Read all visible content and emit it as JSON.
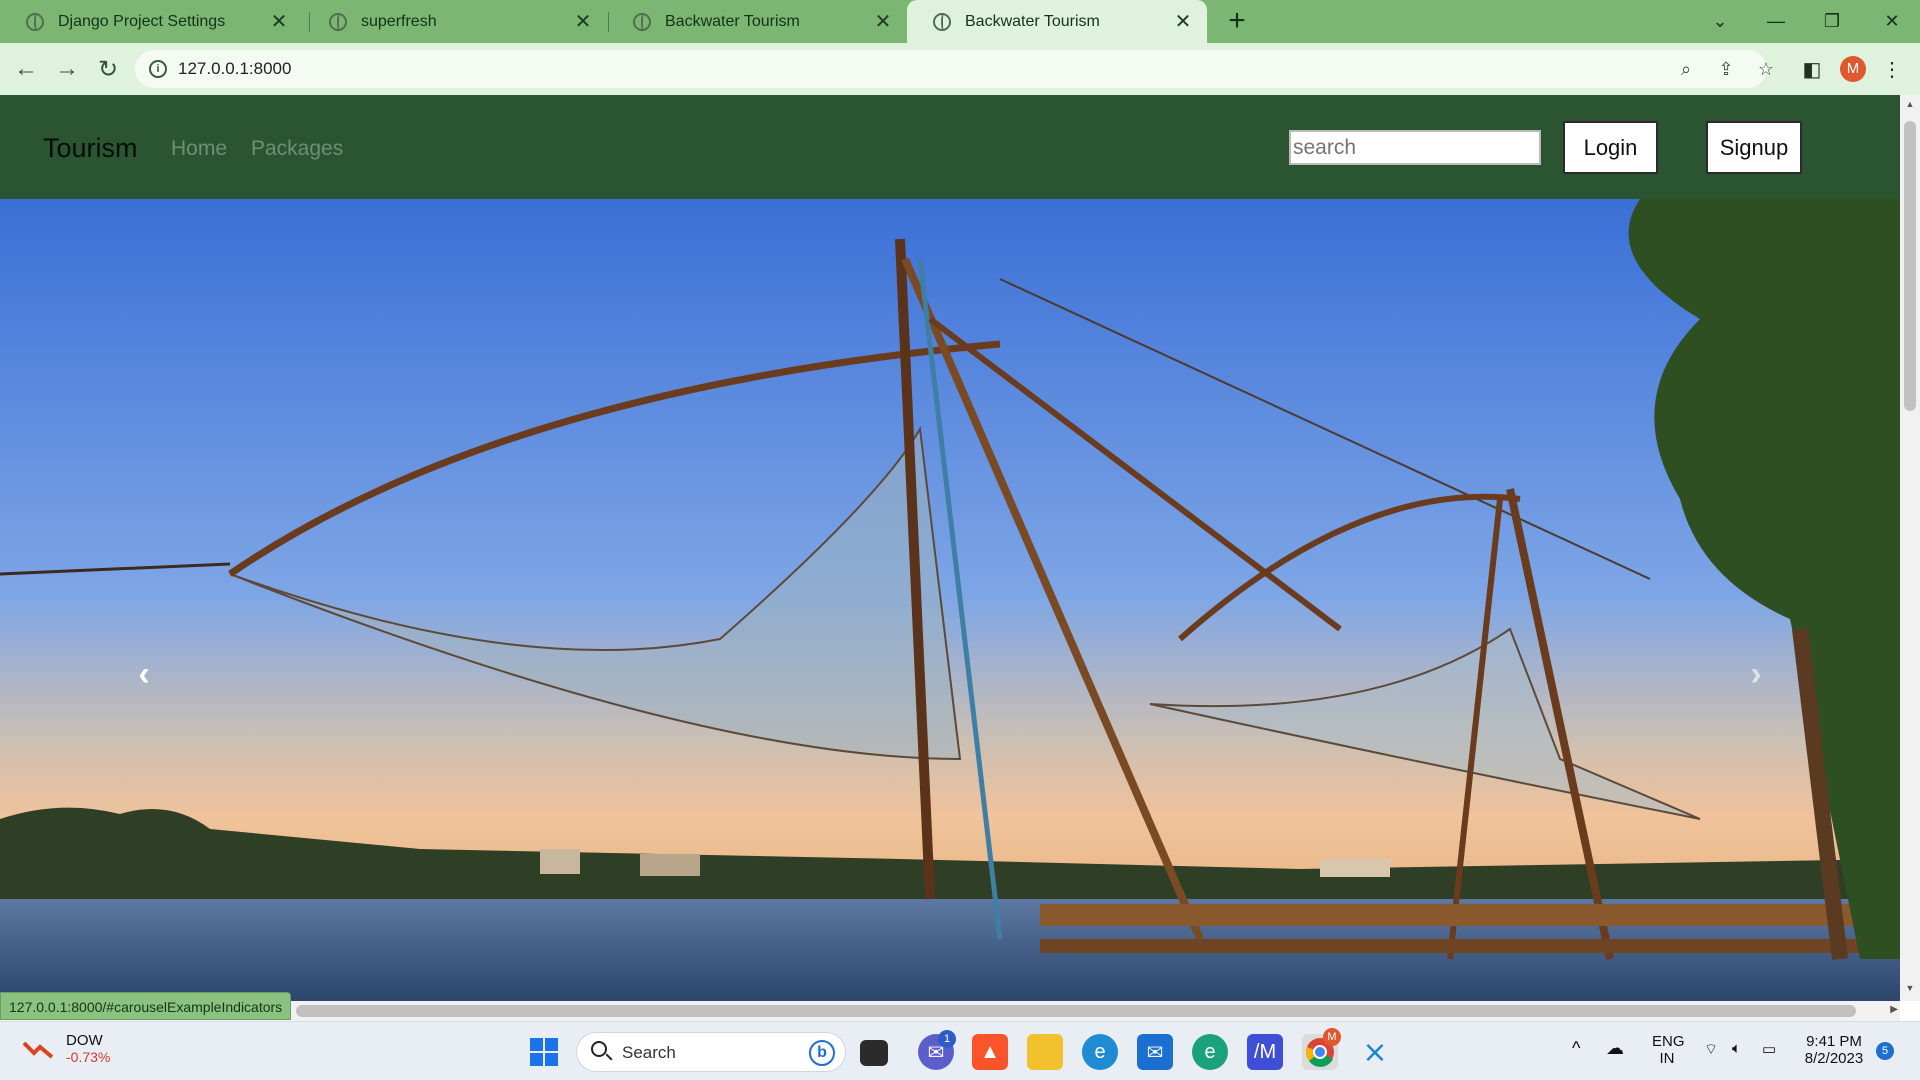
{
  "browser": {
    "tabs": [
      {
        "title": "Django Project Settings"
      },
      {
        "title": "superfresh"
      },
      {
        "title": "Backwater Tourism"
      },
      {
        "title": "Backwater Tourism"
      }
    ],
    "url": "127.0.0.1:8000",
    "profile_initial": "M",
    "status_url": "127.0.0.1:8000/#carouselExampleIndicators"
  },
  "site": {
    "brand": "Tourism",
    "nav": [
      {
        "label": "Home"
      },
      {
        "label": "Packages"
      }
    ],
    "search_placeholder": "search",
    "login_label": "Login",
    "signup_label": "Signup"
  },
  "taskbar": {
    "ticker_name": "DOW",
    "ticker_change": "-0.73%",
    "search_label": "Search",
    "teams_badge": "1",
    "chrome_badge": "M",
    "language": "ENG",
    "region": "IN",
    "time": "9:41 PM",
    "date": "8/2/2023",
    "notification_count": "5"
  },
  "colors": {
    "tab_strip": "#7bb673",
    "site_navbar": "#2a5530",
    "sky_top": "#3f74d8",
    "water": "#34527a"
  }
}
